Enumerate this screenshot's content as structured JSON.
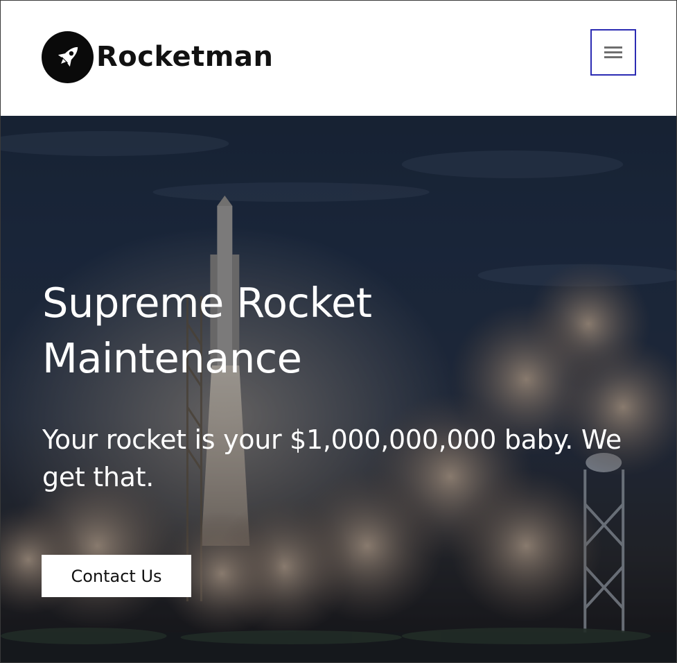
{
  "header": {
    "brand_name": "Rocketman",
    "logo_icon": "rocket-icon",
    "menu_icon": "hamburger-menu-icon",
    "menu_border_color": "#2b2bb3"
  },
  "hero": {
    "title": "Supreme Rocket Maintenance",
    "subtitle": "Your rocket is your $1,000,000,000 baby. We get that.",
    "cta_label": "Contact Us",
    "background_image": "rocket-launch-photo"
  },
  "colors": {
    "header_bg": "#ffffff",
    "hero_text": "#ffffff",
    "button_bg": "#ffffff",
    "button_text": "#111111",
    "logo_badge": "#0a0a0a"
  }
}
